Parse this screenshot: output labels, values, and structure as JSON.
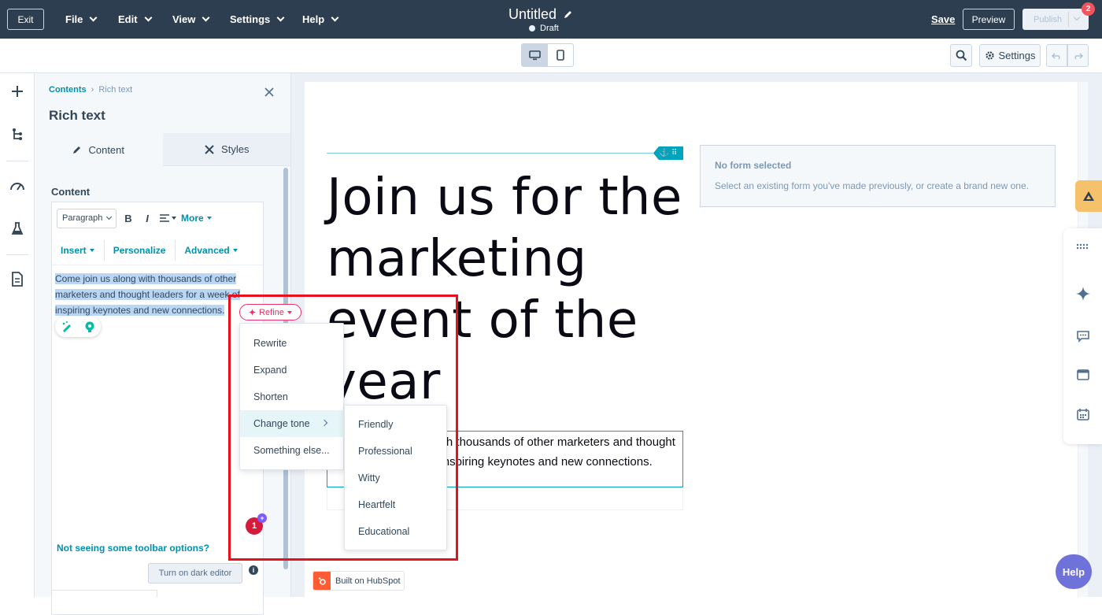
{
  "topbar": {
    "exit_label": "Exit",
    "menus": [
      "File",
      "Edit",
      "View",
      "Settings",
      "Help"
    ],
    "doc_title": "Untitled",
    "status": "Draft",
    "save_label": "Save",
    "preview_label": "Preview",
    "publish_label": "Publish",
    "notification_count": "2"
  },
  "subbar": {
    "settings_label": "Settings"
  },
  "panel": {
    "breadcrumb": {
      "root": "Contents",
      "separator": "›",
      "current": "Rich text"
    },
    "title": "Rich text",
    "tabs": [
      {
        "label": "Content",
        "active": true
      },
      {
        "label": "Styles",
        "active": false
      }
    ],
    "content_label": "Content",
    "toolbar": {
      "paragraph": "Paragraph",
      "bold": "B",
      "italic": "I",
      "more": "More",
      "insert": "Insert",
      "personalize": "Personalize",
      "advanced": "Advanced"
    },
    "selected_text": "Come join us along with thousands of other marketers and thought leaders for a week of inspiring keynotes and new connections.",
    "avatar_count": "1",
    "toolbar_help": "Not seeing some toolbar options?",
    "dark_editor_label": "Turn on dark editor",
    "info": "i"
  },
  "refine": {
    "label": "Refine",
    "menu": [
      "Rewrite",
      "Expand",
      "Shorten",
      "Change tone",
      "Something else..."
    ],
    "tone_menu": [
      "Friendly",
      "Professional",
      "Witty",
      "Heartfelt",
      "Educational"
    ]
  },
  "canvas": {
    "anchor_icon": "⚓ ⠿",
    "hero_heading": "Join us for the marketing event of the year",
    "form": {
      "title": "No form selected",
      "subtitle": "Select an existing form you've made previously, or create a brand new one."
    },
    "body_text": "Come join us along with thousands of other marketers and thought leaders for a week of inspiring keynotes and new connections.",
    "built_on": "Built on HubSpot"
  },
  "help_label": "Help",
  "colors": {
    "topbar": "#2d3e50",
    "accent": "#0091ae",
    "refine": "#e8336a",
    "highlight": "#e8101c",
    "help": "#6f72d8"
  }
}
